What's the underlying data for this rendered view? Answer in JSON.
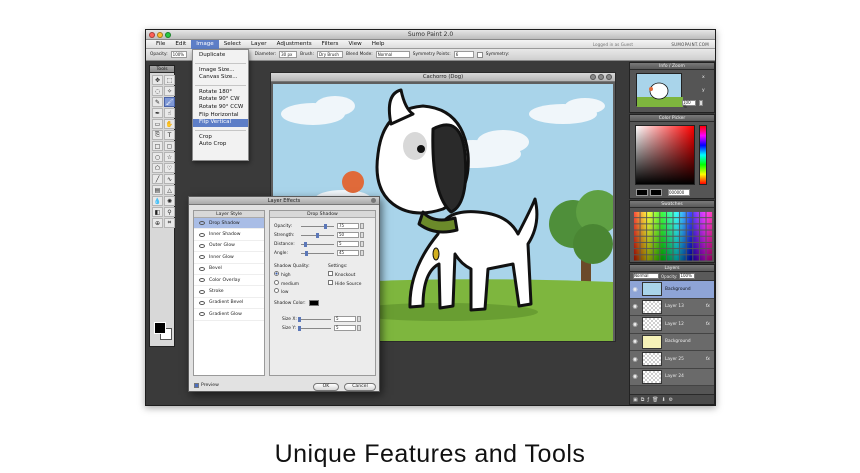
{
  "app": {
    "title": "Sumo Paint 2.0",
    "logged_in": "Logged in as Guest",
    "logo": "SUMOPAINT.COM"
  },
  "menu": [
    "File",
    "Edit",
    "Image",
    "Select",
    "Layer",
    "Adjustments",
    "Filters",
    "View",
    "Help"
  ],
  "options_bar": {
    "opacity_label": "Opacity:",
    "opacity_value": "100%",
    "diameter_label": "Diameter:",
    "diameter_value": "30 px",
    "brush_label": "Brush:",
    "brush_value": "Dry Brush",
    "blend_label": "Blend Mode:",
    "blend_value": "Normal",
    "symmetry_points_label": "Symmetry Points:",
    "symmetry_points_value": "6",
    "symmetry_label": "Symmetry:"
  },
  "tools_panel": {
    "title": "Tools"
  },
  "image_menu": {
    "items": [
      "Duplicate",
      "Image Size...",
      "Canvas Size...",
      "Rotate 180°",
      "Rotate 90° CW",
      "Rotate 90° CCW",
      "Flip Horizontal",
      "Flip Vertical",
      "Crop",
      "Auto Crop"
    ],
    "hovered": "Flip Vertical"
  },
  "document": {
    "title": "Cachorro (Dog)"
  },
  "layer_effects": {
    "title": "Layer Effects",
    "style_header": "Layer Style",
    "styles": [
      "Drop Shadow",
      "Inner Shadow",
      "Outer Glow",
      "Inner Glow",
      "Bevel",
      "Color Overlay",
      "Stroke",
      "Gradient Bevel",
      "Gradient Glow"
    ],
    "selected_style": "Drop Shadow",
    "section_title": "Drop Shadow",
    "params": [
      {
        "label": "Opacity:",
        "value": "75",
        "level": 0.75
      },
      {
        "label": "Strength:",
        "value": "50",
        "level": 0.5
      },
      {
        "label": "Distance:",
        "value": "5",
        "level": 0.1
      },
      {
        "label": "Angle:",
        "value": "45",
        "level": 0.125
      }
    ],
    "quality_label": "Shadow Quality:",
    "quality_options": [
      "high",
      "medium",
      "low"
    ],
    "quality_selected": "high",
    "settings_label": "Settings:",
    "settings": [
      "Knockout",
      "Hide Source"
    ],
    "shadow_color_label": "Shadow Color:",
    "shadow_color": "#000000",
    "size_x_label": "Size X:",
    "size_x_value": "5",
    "size_y_label": "Size Y:",
    "size_y_value": "5",
    "preview_label": "Preview",
    "ok_label": "OK",
    "cancel_label": "Cancel"
  },
  "info_zoom": {
    "title": "Info / Zoom",
    "x_label": "x",
    "y_label": "y",
    "zoom": "100 %"
  },
  "color_picker": {
    "title": "Color Picker",
    "hex": "000000"
  },
  "swatches": {
    "title": "Swatches"
  },
  "layers": {
    "title": "Layers",
    "blend": "Normal",
    "opacity_label": "Opacity:",
    "opacity_value": "100%",
    "items": [
      {
        "name": "Background",
        "fx": ""
      },
      {
        "name": "Layer 13",
        "fx": "fx"
      },
      {
        "name": "Layer 12",
        "fx": "fx"
      },
      {
        "name": "Background",
        "fx": ""
      },
      {
        "name": "Layer 25",
        "fx": "fx"
      },
      {
        "name": "Layer 24",
        "fx": ""
      }
    ]
  },
  "caption": "Unique Features and Tools",
  "colors": {
    "accent": "#5d7ec7",
    "sky": "#a9d4ea",
    "grass": "#7eb63e",
    "dog_collar": "#6b8a2a",
    "nose": "#e06a3a"
  }
}
